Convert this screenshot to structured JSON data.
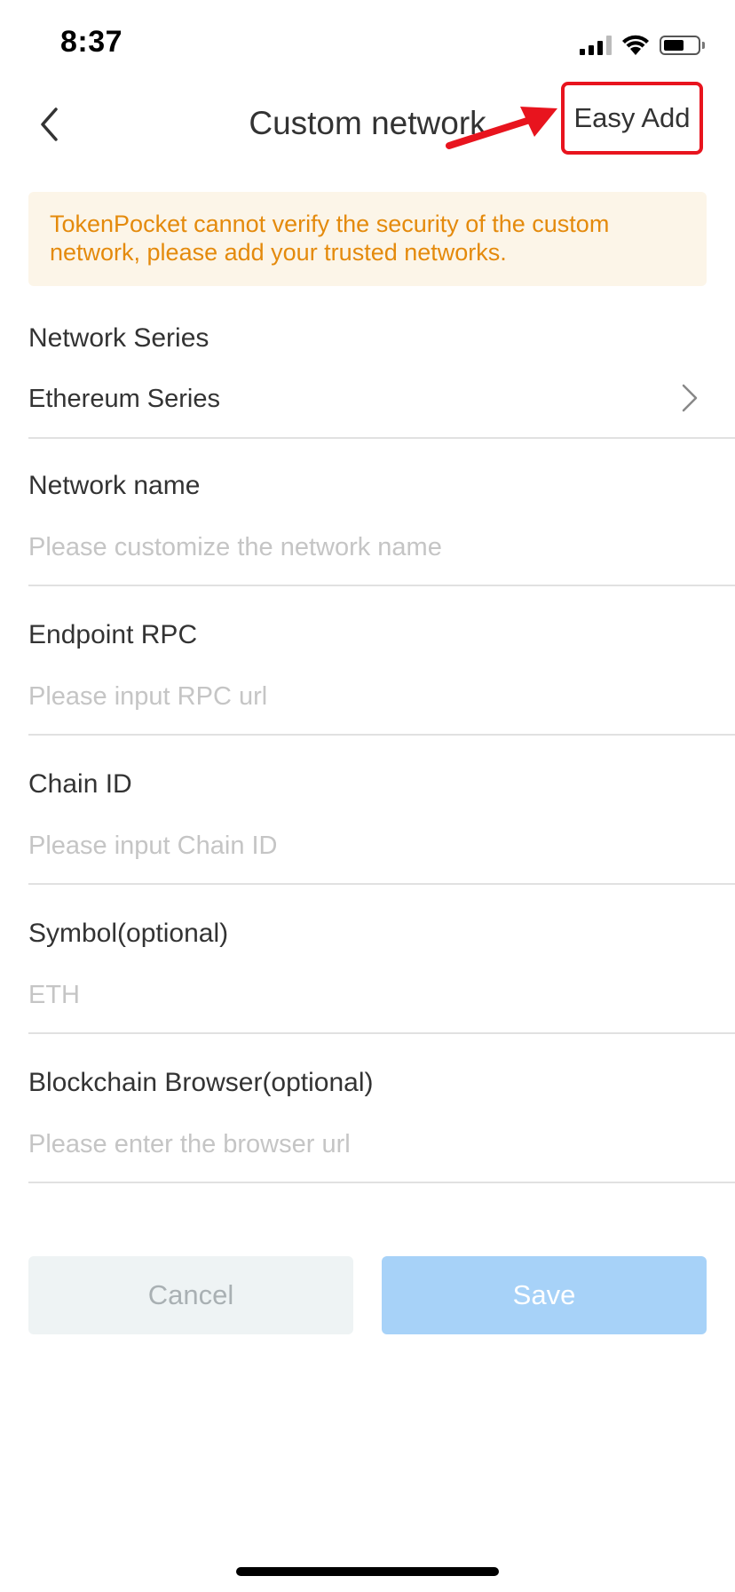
{
  "status_bar": {
    "time": "8:37"
  },
  "header": {
    "title": "Custom network",
    "easy_add_label": "Easy Add"
  },
  "warning": {
    "text": "TokenPocket cannot verify the security of the custom network, please add your trusted networks."
  },
  "fields": {
    "network_series": {
      "label": "Network Series",
      "value": "Ethereum Series"
    },
    "network_name": {
      "label": "Network name",
      "placeholder": "Please customize the network name",
      "value": ""
    },
    "endpoint_rpc": {
      "label": "Endpoint RPC",
      "placeholder": "Please input RPC url",
      "value": ""
    },
    "chain_id": {
      "label": "Chain ID",
      "placeholder": "Please input Chain ID",
      "value": ""
    },
    "symbol": {
      "label": "Symbol(optional)",
      "placeholder": "ETH",
      "value": ""
    },
    "browser": {
      "label": "Blockchain Browser(optional)",
      "placeholder": "Please enter the browser url",
      "value": ""
    }
  },
  "actions": {
    "cancel_label": "Cancel",
    "save_label": "Save"
  },
  "colors": {
    "highlight_red": "#e8141e",
    "warning_text": "#e48a0c",
    "warning_bg": "#fcf5e8",
    "save_bg": "#a7d2f8",
    "cancel_bg": "#eef3f4"
  }
}
